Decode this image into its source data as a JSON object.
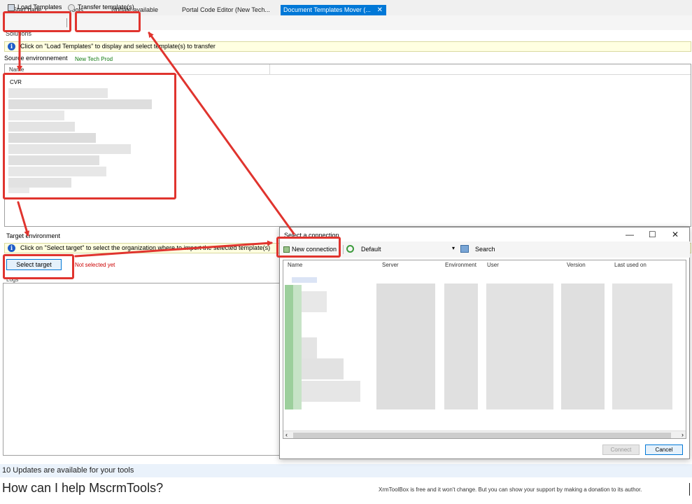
{
  "tabs": [
    {
      "label": "Start page"
    },
    {
      "label": "Tools"
    },
    {
      "label": "Update available"
    },
    {
      "label": "Portal Code Editor (New Tech..."
    },
    {
      "label": "Document Templates Mover (...",
      "close": "✕"
    }
  ],
  "toolbar": {
    "load_label": "Load Templates",
    "transfer_label": "Transfer template(s)"
  },
  "solutions": {
    "label": "Solutions",
    "info": "Click on \"Load Templates\" to display and select template(s) to transfer"
  },
  "source": {
    "label": "Source environnement",
    "value": "New Tech Prod",
    "column_name": "Name",
    "first_row": "CVR"
  },
  "target": {
    "label": "Target environment",
    "info": "Click on \"Select target\" to select the organization where to import the selected template(s)",
    "select_button": "Select target",
    "status": "Not selected yet"
  },
  "logs": {
    "label": "Logs"
  },
  "dialog": {
    "title": "Select a connection",
    "new_connection": "New connection",
    "default_label": "Default",
    "search_label": "Search",
    "columns": [
      "Name",
      "Server",
      "Environment",
      "User",
      "Version",
      "Last used on"
    ],
    "connect_button": "Connect",
    "cancel_button": "Cancel",
    "minimize": "—",
    "maximize": "☐",
    "close": "✕"
  },
  "status_bar": {
    "updates": "10 Updates are available for your tools"
  },
  "footer": {
    "help": "How can I help MscrmTools?",
    "donation": "XrmToolBox is free and it won't change. But you can show your support by making a donation to its author."
  },
  "colors": {
    "accent": "#0078d7",
    "annotation": "#e0342e",
    "env_value": "#127a12",
    "warning_text": "#cc0000"
  }
}
